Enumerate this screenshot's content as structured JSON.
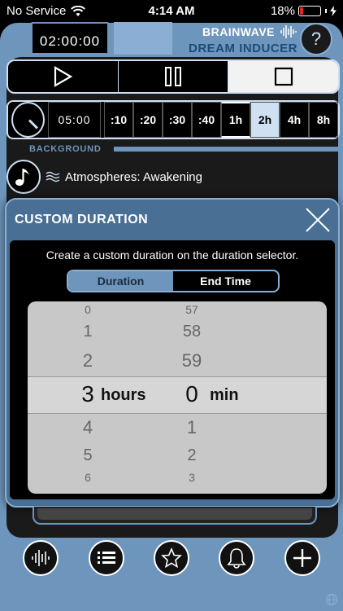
{
  "status": {
    "carrier": "No Service",
    "time": "4:14 AM",
    "battery": "18%",
    "battery_level": 0.18
  },
  "header": {
    "timer": "02:00:00",
    "brand_top": "BRAINWAVE",
    "brand_bottom": "DREAM INDUCER",
    "help": "?"
  },
  "duration": {
    "time": "05:00",
    "options": [
      ":10",
      ":20",
      ":30",
      ":40",
      "1h",
      "2h",
      "4h",
      "8h"
    ],
    "selected": "1h"
  },
  "background": {
    "label": "BACKGROUND",
    "track": "Atmospheres: Awakening"
  },
  "modal": {
    "title": "CUSTOM DURATION",
    "description": "Create a custom duration on the duration selector.",
    "tabs": [
      "Duration",
      "End Time"
    ],
    "active_tab": "Duration",
    "hours": {
      "above": [
        "0",
        "1",
        "2"
      ],
      "selected": "3",
      "unit": "hours",
      "below": [
        "4",
        "5",
        "6"
      ]
    },
    "minutes": {
      "above": [
        "57",
        "58",
        "59"
      ],
      "selected": "0",
      "unit": "min",
      "below": [
        "1",
        "2",
        "3"
      ]
    }
  },
  "colors": {
    "accent": "#6e96bd",
    "accent_light": "#cfe0f2",
    "battery_low": "#e0262a"
  }
}
